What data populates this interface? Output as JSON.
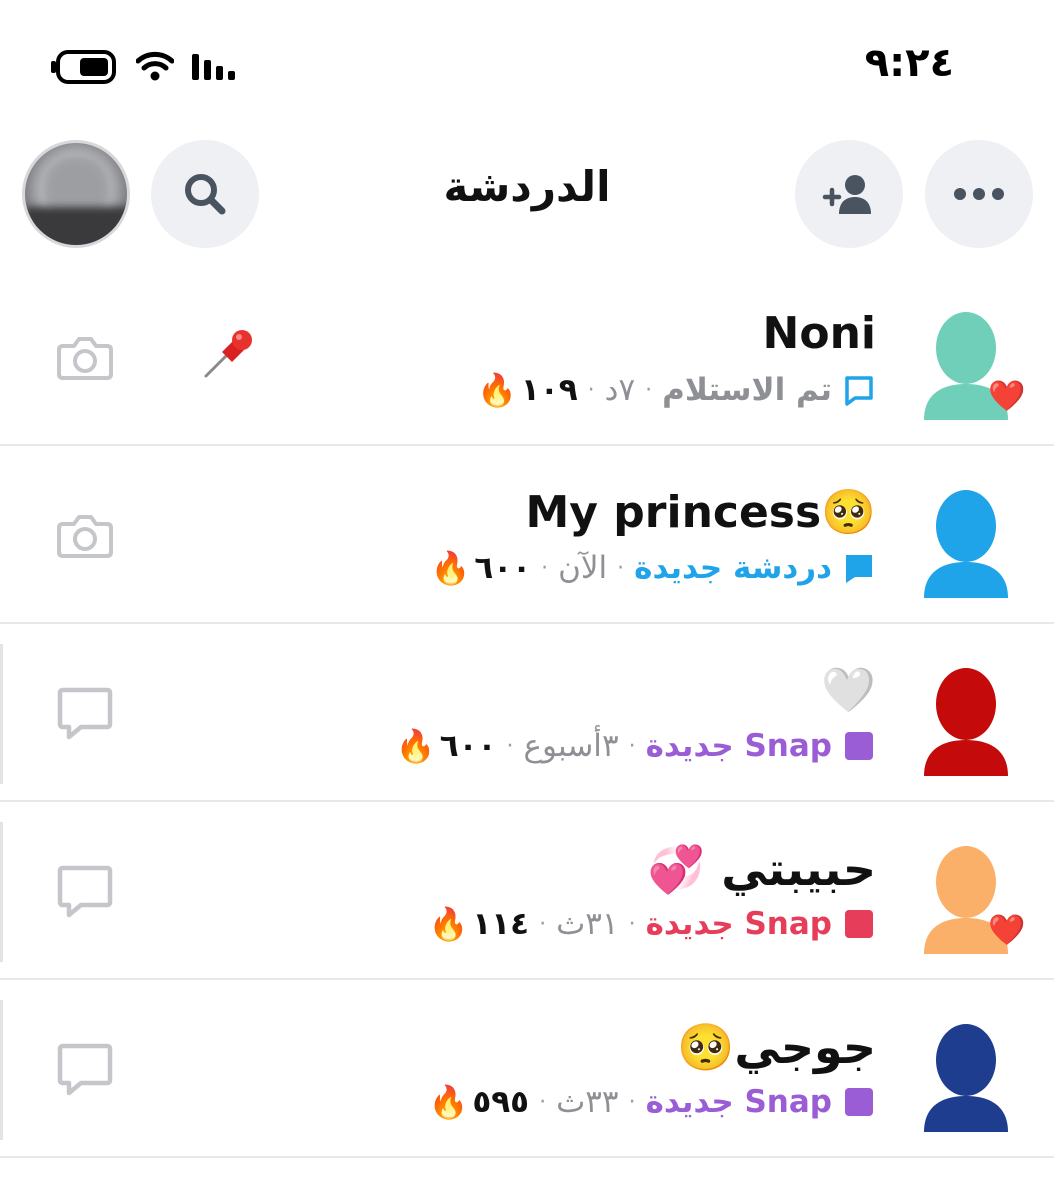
{
  "status_bar": {
    "time": "٩:٢٤"
  },
  "header": {
    "title": "الدردشة",
    "search_icon": "search-icon",
    "add_friend_icon": "add-friend-icon",
    "more_icon": "more-icon"
  },
  "colors": {
    "accent_blue": "#1fa3e9",
    "snap_purple": "#9b5dd6",
    "snap_red": "#e63d5b",
    "icon_gray": "#c4c6ca",
    "circle_bg": "#eef0f3"
  },
  "chats": [
    {
      "name": "Noni",
      "name_emoji": "",
      "avatar_color": "#6fcfb8",
      "badge": "❤️",
      "status_icon": "chat-outline-icon",
      "status_icon_color": "#1fa3e9",
      "status_text": "تم الاستلام",
      "status_color": "#8e9095",
      "time": "٧د",
      "streak": "١٠٩",
      "streak_emoji": "🔥",
      "pinned": true,
      "action_icon": "camera-icon"
    },
    {
      "name": "My princess",
      "name_emoji": "🥺",
      "avatar_color": "#1fa3e9",
      "badge": "",
      "status_icon": "chat-filled-icon",
      "status_icon_color": "#1fa3e9",
      "status_text": "دردشة جديدة",
      "status_color": "#1fa3e9",
      "time": "الآن",
      "streak": "٦٠٠",
      "streak_emoji": "🔥",
      "pinned": false,
      "action_icon": "camera-icon"
    },
    {
      "name": "",
      "name_emoji": "🤍",
      "avatar_color": "#c40a0a",
      "badge": "",
      "status_icon": "snap-square-icon",
      "status_icon_color": "#9b5dd6",
      "status_text": "Snap جديدة",
      "status_color": "#9b5dd6",
      "time": "٣أسبوع",
      "streak": "٦٠٠",
      "streak_emoji": "🔥",
      "pinned": false,
      "action_icon": "chat-reply-icon"
    },
    {
      "name": "حبيبتي",
      "name_emoji": "💞",
      "avatar_color": "#fbb06a",
      "badge": "❤️",
      "status_icon": "snap-square-icon",
      "status_icon_color": "#e63d5b",
      "status_text": "Snap جديدة",
      "status_color": "#e63d5b",
      "time": "٣١ث",
      "streak": "١١٤",
      "streak_emoji": "🔥",
      "pinned": false,
      "action_icon": "chat-reply-icon"
    },
    {
      "name": "جوجي",
      "name_emoji": "🥺",
      "avatar_color": "#1e3d8f",
      "badge": "",
      "status_icon": "snap-square-icon",
      "status_icon_color": "#9b5dd6",
      "status_text": "Snap جديدة",
      "status_color": "#9b5dd6",
      "time": "٣٣ث",
      "streak": "٥٩٥",
      "streak_emoji": "🔥",
      "pinned": false,
      "action_icon": "chat-reply-icon"
    }
  ]
}
